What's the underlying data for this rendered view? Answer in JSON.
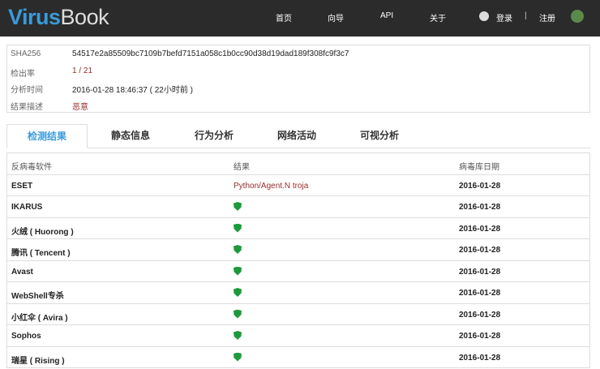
{
  "header": {
    "logo_a": "Virus",
    "logo_b": "Book",
    "nav": [
      "首页",
      "向导",
      "API",
      "关于"
    ],
    "login": "登录",
    "sep": "|",
    "register": "注册"
  },
  "info": [
    {
      "label": "SHA256",
      "value": "54517e2a85509bc7109b7befd7151a058c1b0cc90d38d19dad189f308fc9f3c7"
    },
    {
      "label": "检出率",
      "value": "1 / 21"
    },
    {
      "label": "分析时间",
      "value": "2016-01-28 18:46:37 ( 22小时前 )"
    },
    {
      "label": "结果描述",
      "value": "恶意"
    }
  ],
  "tabs": [
    "检测结果",
    "静态信息",
    "行为分析",
    "网络活动",
    "可视分析"
  ],
  "table": {
    "headers": [
      "反病毒软件",
      "结果",
      "病毒库日期"
    ],
    "rows": [
      {
        "av": "ESET",
        "result": "Python/Agent.N troja",
        "date": "2016-01-28"
      },
      {
        "av": "IKARUS",
        "result": "",
        "date": "2016-01-28"
      },
      {
        "av": "火绒 ( Huorong )",
        "result": "",
        "date": "2016-01-28"
      },
      {
        "av": "腾讯 ( Tencent )",
        "result": "",
        "date": "2016-01-28"
      },
      {
        "av": "Avast",
        "result": "",
        "date": "2016-01-28"
      },
      {
        "av": "WebShell专杀",
        "result": "",
        "date": "2016-01-28"
      },
      {
        "av": "小红伞 ( Avira )",
        "result": "",
        "date": "2016-01-28"
      },
      {
        "av": "Sophos",
        "result": "",
        "date": "2016-01-28"
      },
      {
        "av": "瑞星 ( Rising )",
        "result": "",
        "date": "2016-01-28"
      }
    ]
  }
}
